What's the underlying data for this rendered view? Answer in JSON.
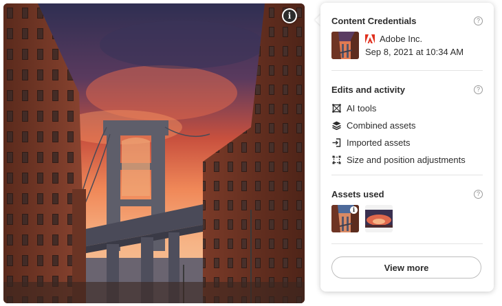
{
  "credentials": {
    "title": "Content Credentials",
    "help_icon": "help-circle-icon",
    "issuer": "Adobe Inc.",
    "date": "Sep 8, 2021 at 10:34 AM"
  },
  "edits": {
    "title": "Edits and activity",
    "help_icon": "help-circle-icon",
    "items": [
      {
        "label": "AI tools",
        "icon": "ai-tools-icon"
      },
      {
        "label": "Combined assets",
        "icon": "layers-icon"
      },
      {
        "label": "Imported assets",
        "icon": "import-icon"
      },
      {
        "label": "Size and position adjustments",
        "icon": "transform-icon"
      }
    ]
  },
  "assets_used": {
    "title": "Assets used",
    "help_icon": "help-circle-icon",
    "items": [
      {
        "name": "bridge-asset-thumbnail",
        "has_info": true
      },
      {
        "name": "sunset-sky-asset-thumbnail",
        "has_info": false
      }
    ]
  },
  "view_more_label": "View more",
  "info_badge_glyph": "i",
  "colors": {
    "text": "#2c2c2c",
    "adobe_red": "#e0301e",
    "divider": "#e3e3e3"
  }
}
